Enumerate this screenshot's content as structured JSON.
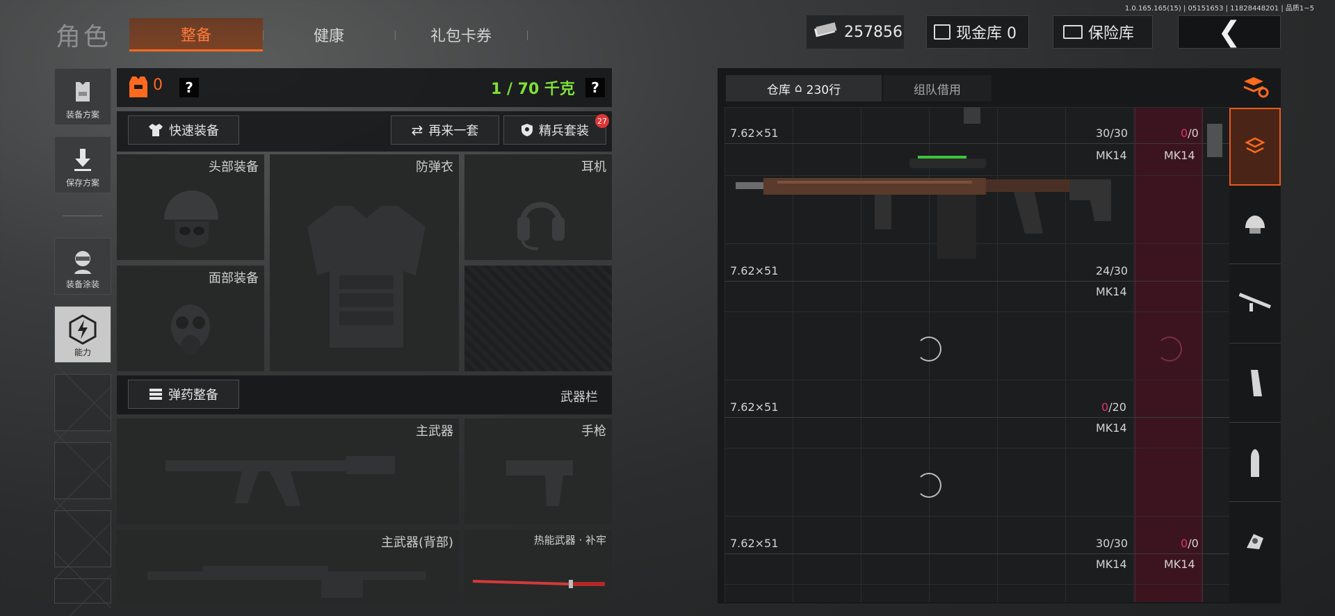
{
  "version": "1.0.165.165(15) | 05151653 | 11828448201 | 品质1~5",
  "header": {
    "title": "角色",
    "tabs": [
      "整备",
      "健康",
      "礼包卡券"
    ],
    "money": "257856",
    "cashbox": "现金库 0",
    "insurance": "保险库",
    "back_icon": "❮"
  },
  "sidebar": {
    "items": [
      "装备方案",
      "保存方案",
      "装备涂装",
      "能力"
    ]
  },
  "loadout": {
    "armor_count": "0",
    "question": "?",
    "weight": "1 / 70 千克",
    "quick_equip": "快速装备",
    "reroll": "再来一套",
    "elite_set": "精兵套装",
    "elite_badge": "27",
    "slots": {
      "head": "头部装备",
      "vest": "防弹衣",
      "ear": "耳机",
      "face": "面部装备"
    },
    "ammo_btn": "弹药整备",
    "weapon_bar": "武器栏",
    "weapons": {
      "primary": "主武器",
      "pistol": "手枪",
      "secondary": "主武器(背部)",
      "melee": "热能武器 · 补牢"
    }
  },
  "warehouse": {
    "tab_storage": "仓库",
    "tab_count": "230行",
    "tab_team": "组队借用",
    "rows": [
      {
        "caliber": "7.62×51",
        "ammo": "30/30",
        "ammo_red": "",
        "ammo_red_denom": "",
        "name": "",
        "red_ammo": "0",
        "red_denom": "/0"
      },
      {
        "caliber": "7.62×51",
        "ammo": "24/30",
        "name": "MK14",
        "red_name": "MK14"
      },
      {
        "caliber": "7.62×51",
        "ammo_red": "0",
        "ammo_rest": "/20",
        "name": "MK14"
      },
      {
        "caliber": "7.62×51",
        "ammo": "30/30",
        "name": "MK14",
        "red_ammo": "0",
        "red_denom": "/0"
      },
      {
        "name": "MK14",
        "red_name": "MK14"
      }
    ]
  },
  "colors": {
    "accent": "#ff6a1f",
    "weight_green": "#7ee03c",
    "red_text": "#e0336a"
  }
}
